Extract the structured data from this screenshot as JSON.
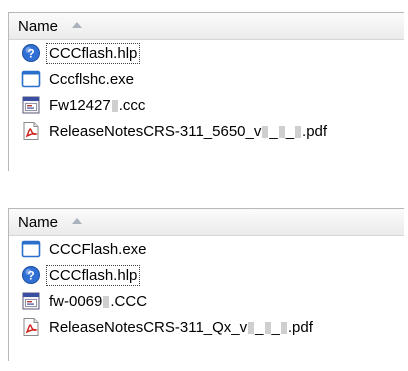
{
  "panel1": {
    "header": "Name",
    "rows": [
      {
        "name": "CCCflash.hlp",
        "icon": "help-file-icon"
      },
      {
        "name": "Cccflshc.exe",
        "icon": "exe-file-icon"
      },
      {
        "name_parts": [
          "Fw12427",
          ".ccc"
        ],
        "icon": "ccc-file-icon"
      },
      {
        "name_parts": [
          "ReleaseNotesCRS-311_5650_v",
          "_",
          "_",
          ".pdf"
        ],
        "icon": "pdf-file-icon"
      }
    ]
  },
  "panel2": {
    "header": "Name",
    "rows": [
      {
        "name": "CCCFlash.exe",
        "icon": "exe-file-icon"
      },
      {
        "name": "CCCflash.hlp",
        "icon": "help-file-icon"
      },
      {
        "name_parts": [
          "fw-0069",
          ".CCC"
        ],
        "icon": "ccc-file-icon"
      },
      {
        "name_parts": [
          "ReleaseNotesCRS-311_Qx_v",
          "_",
          "_",
          ".pdf"
        ],
        "icon": "pdf-file-icon"
      }
    ]
  }
}
